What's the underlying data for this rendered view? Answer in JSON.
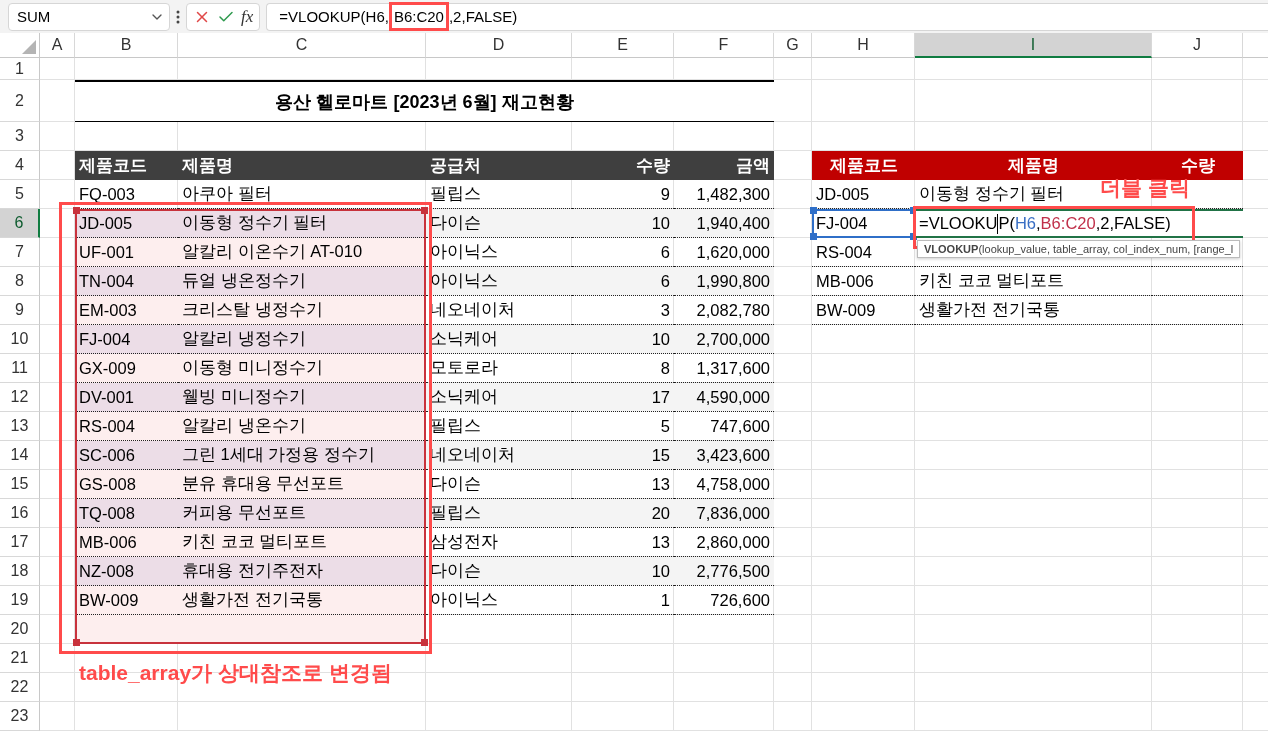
{
  "name_box": {
    "value": "SUM"
  },
  "formula_bar": {
    "function_label": "fx",
    "value_parts": [
      {
        "text": "=VLOOKUP(H6,",
        "highlighted": false
      },
      {
        "text": "B6:C20",
        "highlighted": true
      },
      {
        "text": ",2,FALSE)",
        "highlighted": false
      }
    ]
  },
  "columns": [
    {
      "label": "A",
      "selected": false
    },
    {
      "label": "B",
      "selected": false
    },
    {
      "label": "C",
      "selected": false
    },
    {
      "label": "D",
      "selected": false
    },
    {
      "label": "E",
      "selected": false
    },
    {
      "label": "F",
      "selected": false
    },
    {
      "label": "G",
      "selected": false
    },
    {
      "label": "H",
      "selected": false
    },
    {
      "label": "I",
      "selected": true
    },
    {
      "label": "J",
      "selected": false
    }
  ],
  "rows": [
    {
      "label": "1",
      "selected": false
    },
    {
      "label": "2",
      "selected": false
    },
    {
      "label": "3",
      "selected": false
    },
    {
      "label": "4",
      "selected": false
    },
    {
      "label": "5",
      "selected": false
    },
    {
      "label": "6",
      "selected": true
    },
    {
      "label": "7",
      "selected": false
    },
    {
      "label": "8",
      "selected": false
    },
    {
      "label": "9",
      "selected": false
    },
    {
      "label": "10",
      "selected": false
    },
    {
      "label": "11",
      "selected": false
    },
    {
      "label": "12",
      "selected": false
    },
    {
      "label": "13",
      "selected": false
    },
    {
      "label": "14",
      "selected": false
    },
    {
      "label": "15",
      "selected": false
    },
    {
      "label": "16",
      "selected": false
    },
    {
      "label": "17",
      "selected": false
    },
    {
      "label": "18",
      "selected": false
    },
    {
      "label": "19",
      "selected": false
    },
    {
      "label": "20",
      "selected": false
    },
    {
      "label": "21",
      "selected": false
    },
    {
      "label": "22",
      "selected": false
    },
    {
      "label": "23",
      "selected": false
    }
  ],
  "title": "용산 헬로마트 [2023년 6월] 재고현황",
  "inventory": {
    "columns": [
      "제품코드",
      "제품명",
      "공급처",
      "수량",
      "금액"
    ],
    "rows": [
      {
        "code": "FQ-003",
        "name": "아쿠아 필터",
        "supplier": "필립스",
        "qty": "9",
        "amount": "1,482,300",
        "highlighted": false
      },
      {
        "code": "JD-005",
        "name": "이동형 정수기 필터",
        "supplier": "다이슨",
        "qty": "10",
        "amount": "1,940,400",
        "highlighted": true
      },
      {
        "code": "UF-001",
        "name": "알칼리 이온수기 AT-010",
        "supplier": "아이닉스",
        "qty": "6",
        "amount": "1,620,000",
        "highlighted": true
      },
      {
        "code": "TN-004",
        "name": "듀얼 냉온정수기",
        "supplier": "아이닉스",
        "qty": "6",
        "amount": "1,990,800",
        "highlighted": true
      },
      {
        "code": "EM-003",
        "name": "크리스탈 냉정수기",
        "supplier": "네오네이처",
        "qty": "3",
        "amount": "2,082,780",
        "highlighted": true
      },
      {
        "code": "FJ-004",
        "name": "알칼리 냉정수기",
        "supplier": "소닉케어",
        "qty": "10",
        "amount": "2,700,000",
        "highlighted": true
      },
      {
        "code": "GX-009",
        "name": "이동형 미니정수기",
        "supplier": "모토로라",
        "qty": "8",
        "amount": "1,317,600",
        "highlighted": true
      },
      {
        "code": "DV-001",
        "name": "웰빙 미니정수기",
        "supplier": "소닉케어",
        "qty": "17",
        "amount": "4,590,000",
        "highlighted": true
      },
      {
        "code": "RS-004",
        "name": "알칼리 냉온수기",
        "supplier": "필립스",
        "qty": "5",
        "amount": "747,600",
        "highlighted": true
      },
      {
        "code": "SC-006",
        "name": "그린 1세대 가정용 정수기",
        "supplier": "네오네이처",
        "qty": "15",
        "amount": "3,423,600",
        "highlighted": true
      },
      {
        "code": "GS-008",
        "name": "분유 휴대용 무선포트",
        "supplier": "다이슨",
        "qty": "13",
        "amount": "4,758,000",
        "highlighted": true
      },
      {
        "code": "TQ-008",
        "name": "커피용 무선포트",
        "supplier": "필립스",
        "qty": "20",
        "amount": "7,836,000",
        "highlighted": true
      },
      {
        "code": "MB-006",
        "name": "키친 코코 멀티포트",
        "supplier": "삼성전자",
        "qty": "13",
        "amount": "2,860,000",
        "highlighted": true
      },
      {
        "code": "NZ-008",
        "name": "휴대용 전기주전자",
        "supplier": "다이슨",
        "qty": "10",
        "amount": "2,776,500",
        "highlighted": true
      },
      {
        "code": "BW-009",
        "name": "생활가전 전기국통",
        "supplier": "아이닉스",
        "qty": "1",
        "amount": "726,600",
        "highlighted": true
      }
    ]
  },
  "lookup": {
    "columns": [
      "제품코드",
      "제품명",
      "수량"
    ],
    "rows": [
      {
        "kind": "value",
        "code": "JD-005",
        "name": "이동형 정수기 필터",
        "referenced": false
      },
      {
        "kind": "editing",
        "code": "FJ-004",
        "referenced": true,
        "formula_parts": [
          {
            "kind": "text",
            "text": "=VLOOKU"
          },
          {
            "kind": "caret"
          },
          {
            "kind": "text",
            "text": "P("
          },
          {
            "kind": "reference",
            "text": "H6",
            "color": "#3a6fc4"
          },
          {
            "kind": "text",
            "text": ","
          },
          {
            "kind": "reference",
            "text": "B6:C20",
            "color": "#c0304a"
          },
          {
            "kind": "text",
            "text": ",2,FALSE)"
          }
        ]
      },
      {
        "kind": "value",
        "code": "RS-004",
        "referenced": false
      },
      {
        "kind": "value",
        "code": "MB-006",
        "name": "키친 코코 멀티포트",
        "referenced": false
      },
      {
        "kind": "value",
        "code": "BW-009",
        "name": "생활가전 전기국통",
        "referenced": false
      }
    ]
  },
  "tooltip": {
    "text": "**VLOOKUP**(lookup_value, table_array, col_index_num, [range_l"
  },
  "annotations": {
    "double_click": "더블 클릭",
    "range_note": "table_array가 상대참조로 변경됨"
  }
}
